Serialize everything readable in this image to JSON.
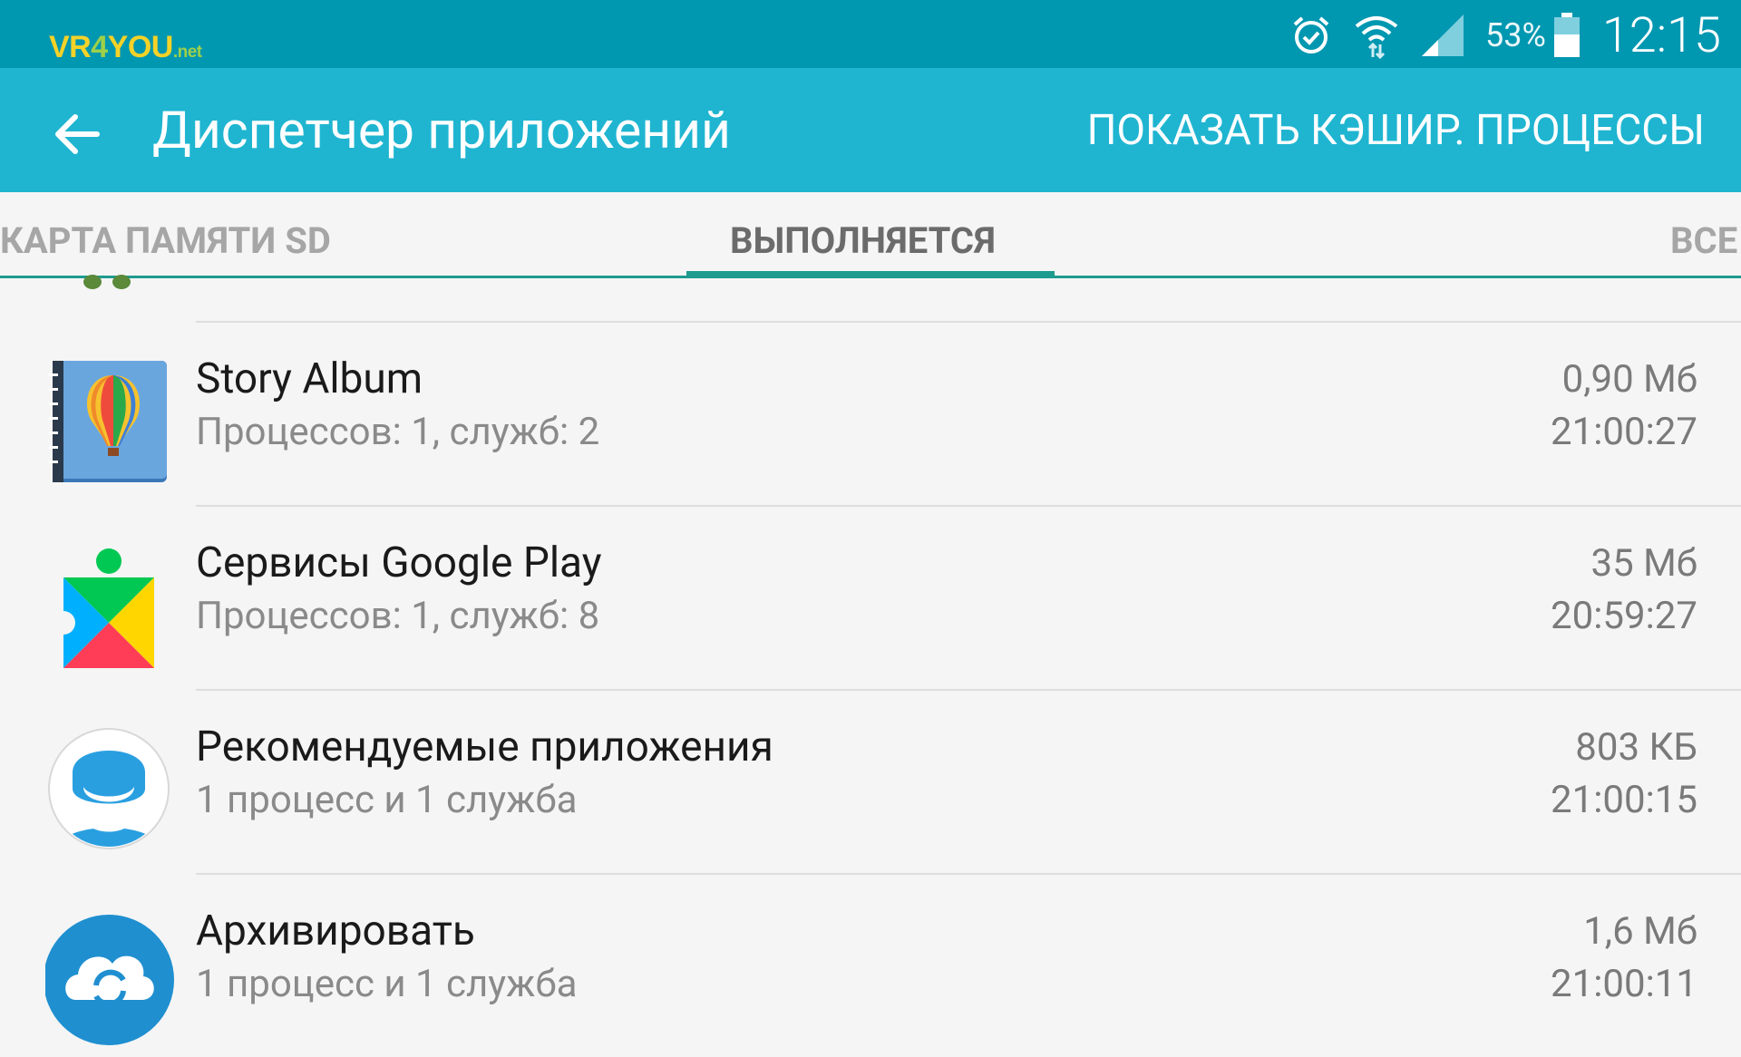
{
  "status_bar": {
    "watermark": {
      "part1": "VR",
      "part2": "4",
      "part3": "YOU",
      "part4": ".net"
    },
    "battery_percent": "53%",
    "time": "12:15",
    "icons": [
      "alarm-icon",
      "wifi-icon",
      "signal-icon",
      "battery-icon"
    ]
  },
  "app_bar": {
    "title": "Диспетчер приложений",
    "action": "ПОКАЗАТЬ КЭШИР. ПРОЦЕССЫ",
    "back_icon": "arrow-back-icon",
    "color": "#1fb5d1"
  },
  "tabs": [
    {
      "label": "КАРТА ПАМЯТИ SD",
      "active": false
    },
    {
      "label": "ВЫПОЛНЯЕТСЯ",
      "active": true
    },
    {
      "label": "ВСЕ",
      "active": false
    }
  ],
  "apps": [
    {
      "name": "Story Album",
      "details": "Процессов: 1, служб: 2",
      "size": "0,90 Мб",
      "time": "21:00:27",
      "icon": "story-album-icon"
    },
    {
      "name": "Сервисы Google Play",
      "details": "Процессов: 1, служб: 8",
      "size": "35 Мб",
      "time": "20:59:27",
      "icon": "google-play-services-icon"
    },
    {
      "name": "Рекомендуемые приложения",
      "details": "1 процесс и 1 служба",
      "size": "803 КБ",
      "time": "21:00:15",
      "icon": "recommended-apps-icon"
    },
    {
      "name": "Архивировать",
      "details": "1 процесс и 1 служба",
      "size": "1,6 Мб",
      "time": "21:00:11",
      "icon": "archive-icon"
    }
  ],
  "accent_color": "#1e9b8f"
}
